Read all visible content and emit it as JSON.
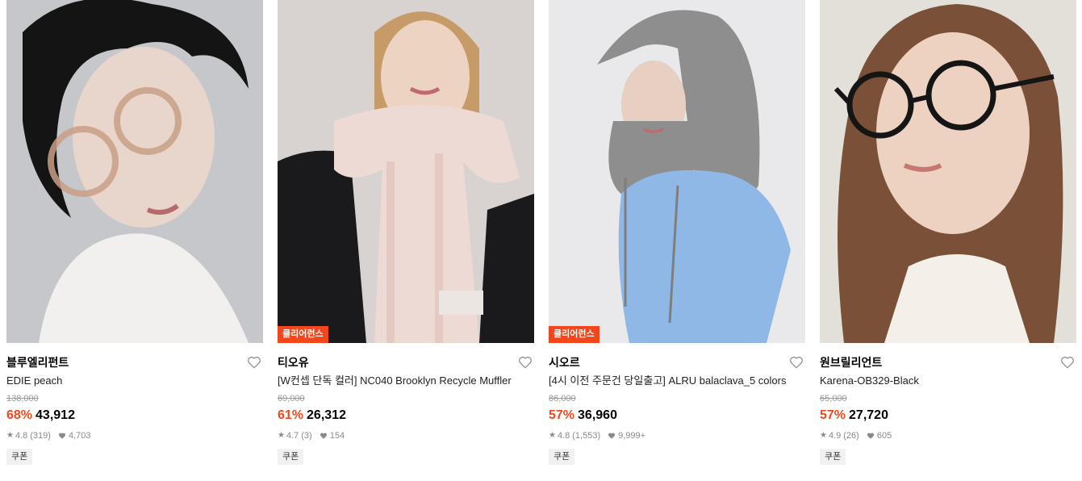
{
  "products": [
    {
      "brand": "블루엘리펀트",
      "name": "EDIE peach",
      "original_price": "138,000",
      "discount": "68%",
      "price": "43,912",
      "rating": "4.8",
      "review_count": "(319)",
      "likes": "4,703",
      "coupon": "쿠폰",
      "badge": null
    },
    {
      "brand": "티오유",
      "name": "[W컨셉 단독 컬러] NC040 Brooklyn Recycle Muffler",
      "original_price": "69,000",
      "discount": "61%",
      "price": "26,312",
      "rating": "4.7",
      "review_count": "(3)",
      "likes": "154",
      "coupon": "쿠폰",
      "badge": "클리어런스"
    },
    {
      "brand": "시오르",
      "name": "[4시 이전 주문건 당일출고] ALRU balaclava_5 colors",
      "original_price": "86,000",
      "discount": "57%",
      "price": "36,960",
      "rating": "4.8",
      "review_count": "(1,553)",
      "likes": "9,999+",
      "coupon": "쿠폰",
      "badge": "클리어런스"
    },
    {
      "brand": "원브릴리언트",
      "name": "Karena-OB329-Black",
      "original_price": "65,000",
      "discount": "57%",
      "price": "27,720",
      "rating": "4.9",
      "review_count": "(26)",
      "likes": "605",
      "coupon": "쿠폰",
      "badge": null
    }
  ],
  "colors": {
    "accent": "#f2471d",
    "muted": "#8a8a8a"
  }
}
